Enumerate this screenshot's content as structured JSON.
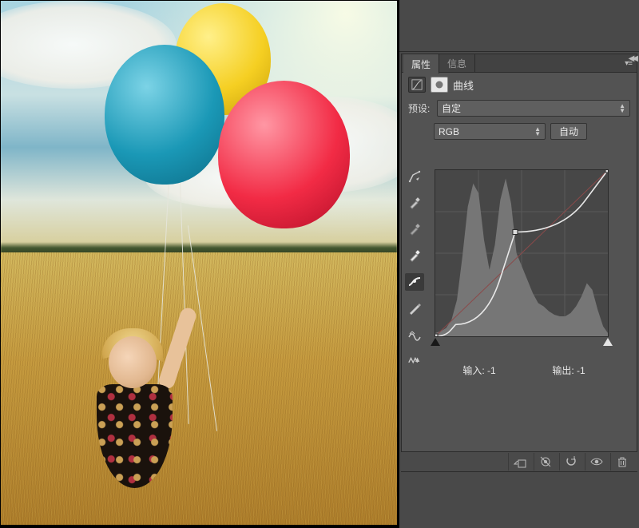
{
  "tabs": {
    "properties": "属性",
    "info": "信息"
  },
  "adjustment": {
    "title": "曲线"
  },
  "preset": {
    "label": "预设:",
    "value": "自定"
  },
  "channel": {
    "value": "RGB",
    "autoLabel": "自动"
  },
  "io": {
    "inputLabel": "输入:",
    "inputValue": "-1",
    "outputLabel": "输出:",
    "outputValue": "-1"
  },
  "tools": [
    {
      "name": "target-adjust-tool"
    },
    {
      "name": "eyedropper-black-tool"
    },
    {
      "name": "eyedropper-gray-tool"
    },
    {
      "name": "eyedropper-white-tool"
    },
    {
      "name": "curve-point-tool"
    },
    {
      "name": "pencil-curve-tool"
    },
    {
      "name": "smooth-tool"
    },
    {
      "name": "clip-warning-tool"
    }
  ],
  "footer": [
    {
      "name": "clip-to-layer-icon"
    },
    {
      "name": "view-previous-icon"
    },
    {
      "name": "reset-icon"
    },
    {
      "name": "visibility-icon"
    },
    {
      "name": "trash-icon"
    }
  ],
  "chart_data": {
    "type": "line",
    "title": "曲线",
    "xlabel": "输入",
    "ylabel": "输出",
    "xlim": [
      0,
      255
    ],
    "ylim": [
      0,
      255
    ],
    "grid": true,
    "series": [
      {
        "name": "baseline",
        "x": [
          0,
          255
        ],
        "y": [
          0,
          255
        ]
      },
      {
        "name": "curve",
        "x": [
          0,
          30,
          118,
          255
        ],
        "y": [
          0,
          18,
          160,
          255
        ]
      }
    ],
    "control_points": [
      {
        "x": 0,
        "y": 0
      },
      {
        "x": 118,
        "y": 160
      },
      {
        "x": 255,
        "y": 255
      }
    ],
    "histogram": {
      "bins_x": [
        0,
        8,
        16,
        24,
        32,
        40,
        48,
        56,
        64,
        72,
        80,
        88,
        96,
        104,
        112,
        120,
        128,
        136,
        144,
        152,
        160,
        168,
        176,
        184,
        192,
        200,
        208,
        216,
        224,
        232,
        240,
        248,
        255
      ],
      "heights_pct": [
        2,
        3,
        5,
        10,
        22,
        48,
        78,
        92,
        86,
        58,
        40,
        55,
        82,
        95,
        80,
        50,
        42,
        34,
        26,
        20,
        18,
        15,
        13,
        12,
        12,
        14,
        18,
        24,
        32,
        28,
        16,
        6,
        2
      ]
    }
  }
}
